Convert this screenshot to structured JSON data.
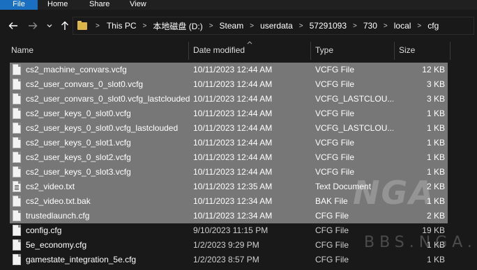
{
  "ribbon": {
    "tabs": [
      {
        "label": "File"
      },
      {
        "label": "Home"
      },
      {
        "label": "Share"
      },
      {
        "label": "View"
      }
    ]
  },
  "nav": {
    "back_icon": "arrow-left",
    "forward_icon": "arrow-right",
    "recent_icon": "chevron-down",
    "up_icon": "arrow-up"
  },
  "address": {
    "crumbs": [
      "This PC",
      "本地磁盘 (D:)",
      "Steam",
      "userdata",
      "57291093",
      "730",
      "local",
      "cfg"
    ]
  },
  "columns": {
    "name": "Name",
    "date": "Date modified",
    "type": "Type",
    "size": "Size"
  },
  "files": [
    {
      "name": "cs2_machine_convars.vcfg",
      "date": "10/11/2023 12:44 AM",
      "type": "VCFG File",
      "size": "12 KB",
      "selected": true,
      "icon": "file"
    },
    {
      "name": "cs2_user_convars_0_slot0.vcfg",
      "date": "10/11/2023 12:44 AM",
      "type": "VCFG File",
      "size": "3 KB",
      "selected": true,
      "icon": "file"
    },
    {
      "name": "cs2_user_convars_0_slot0.vcfg_lastclouded",
      "date": "10/11/2023 12:44 AM",
      "type": "VCFG_LASTCLOU...",
      "size": "3 KB",
      "selected": true,
      "icon": "file"
    },
    {
      "name": "cs2_user_keys_0_slot0.vcfg",
      "date": "10/11/2023 12:44 AM",
      "type": "VCFG File",
      "size": "1 KB",
      "selected": true,
      "icon": "file"
    },
    {
      "name": "cs2_user_keys_0_slot0.vcfg_lastclouded",
      "date": "10/11/2023 12:44 AM",
      "type": "VCFG_LASTCLOU...",
      "size": "1 KB",
      "selected": true,
      "icon": "file"
    },
    {
      "name": "cs2_user_keys_0_slot1.vcfg",
      "date": "10/11/2023 12:44 AM",
      "type": "VCFG File",
      "size": "1 KB",
      "selected": true,
      "icon": "file"
    },
    {
      "name": "cs2_user_keys_0_slot2.vcfg",
      "date": "10/11/2023 12:44 AM",
      "type": "VCFG File",
      "size": "1 KB",
      "selected": true,
      "icon": "file"
    },
    {
      "name": "cs2_user_keys_0_slot3.vcfg",
      "date": "10/11/2023 12:44 AM",
      "type": "VCFG File",
      "size": "1 KB",
      "selected": true,
      "icon": "file"
    },
    {
      "name": "cs2_video.txt",
      "date": "10/11/2023 12:35 AM",
      "type": "Text Document",
      "size": "2 KB",
      "selected": true,
      "icon": "txt"
    },
    {
      "name": "cs2_video.txt.bak",
      "date": "10/11/2023 12:34 AM",
      "type": "BAK File",
      "size": "1 KB",
      "selected": true,
      "icon": "file"
    },
    {
      "name": "trustedlaunch.cfg",
      "date": "10/11/2023 12:34 AM",
      "type": "CFG File",
      "size": "2 KB",
      "selected": true,
      "icon": "file"
    },
    {
      "name": "config.cfg",
      "date": "9/10/2023 11:15 PM",
      "type": "CFG File",
      "size": "19 KB",
      "selected": false,
      "icon": "file"
    },
    {
      "name": "5e_economy.cfg",
      "date": "1/2/2023 9:29 PM",
      "type": "CFG File",
      "size": "1 KB",
      "selected": false,
      "icon": "file"
    },
    {
      "name": "gamestate_integration_5e.cfg",
      "date": "1/2/2023 8:57 PM",
      "type": "CFG File",
      "size": "1 KB",
      "selected": false,
      "icon": "file"
    }
  ],
  "watermark": {
    "logo_text": "NGA",
    "site_text": "BBS.NGA.CN"
  },
  "colors": {
    "selection": "#777777",
    "file_tab": "#1a6fc0",
    "background": "#191919",
    "folder": "#dcb44a"
  }
}
